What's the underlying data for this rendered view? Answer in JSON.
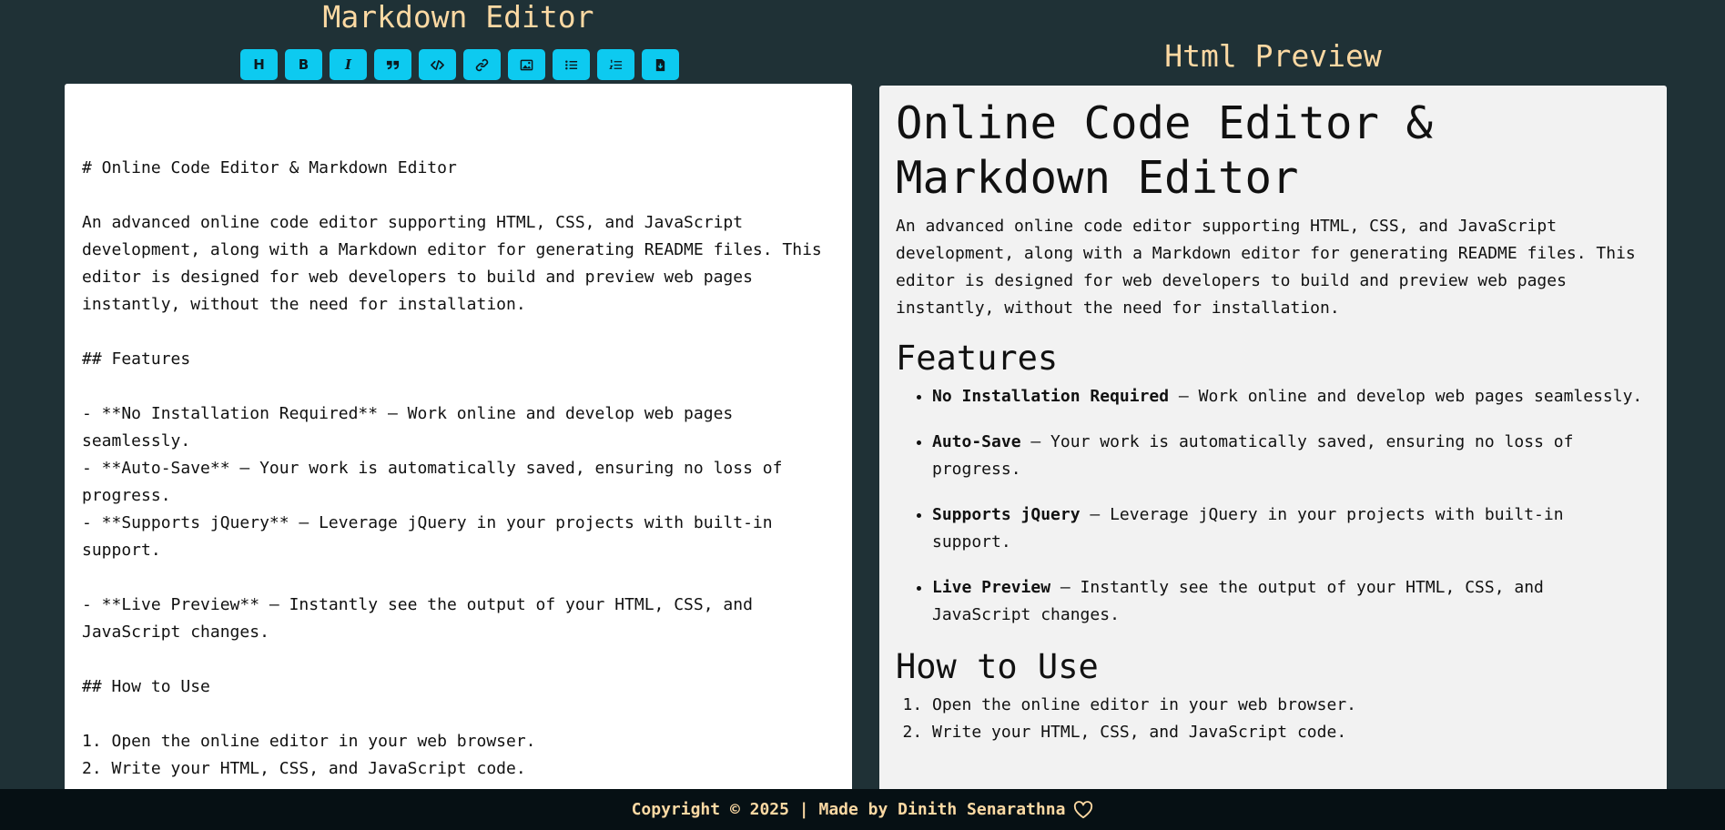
{
  "editor_panel": {
    "title": "Markdown Editor",
    "toolbar": [
      {
        "label": "H",
        "icon": "heading-icon"
      },
      {
        "label": "B",
        "icon": "bold-icon"
      },
      {
        "label": "I",
        "icon": "italic-icon"
      },
      {
        "label": "",
        "icon": "quote-icon"
      },
      {
        "label": "",
        "icon": "code-icon"
      },
      {
        "label": "",
        "icon": "link-icon"
      },
      {
        "label": "",
        "icon": "image-icon"
      },
      {
        "label": "",
        "icon": "unordered-list-icon"
      },
      {
        "label": "",
        "icon": "ordered-list-icon"
      },
      {
        "label": "",
        "icon": "file-download-icon"
      }
    ],
    "content": "# Online Code Editor & Markdown Editor\n\nAn advanced online code editor supporting HTML, CSS, and JavaScript development, along with a Markdown editor for generating README files. This editor is designed for web developers to build and preview web pages instantly, without the need for installation.\n\n## Features\n\n- **No Installation Required** – Work online and develop web pages seamlessly.\n- **Auto-Save** – Your work is automatically saved, ensuring no loss of progress.\n- **Supports jQuery** – Leverage jQuery in your projects with built-in support.\n\n- **Live Preview** – Instantly see the output of your HTML, CSS, and JavaScript changes.\n\n## How to Use\n\n1. Open the online editor in your web browser.\n2. Write your HTML, CSS, and JavaScript code."
  },
  "preview_panel": {
    "title": "Html Preview",
    "h1": "Online Code Editor & Markdown Editor",
    "intro": "An advanced online code editor supporting HTML, CSS, and JavaScript development, along with a Markdown editor for generating README files. This editor is designed for web developers to build and preview web pages instantly, without the need for installation.",
    "features_heading": "Features",
    "features": [
      {
        "bold": "No Installation Required",
        "text": " – Work online and develop web pages seamlessly."
      },
      {
        "bold": "Auto-Save",
        "text": " – Your work is automatically saved, ensuring no loss of progress."
      },
      {
        "bold": "Supports jQuery",
        "text": " – Leverage jQuery in your projects with built-in support."
      },
      {
        "bold": "Live Preview",
        "text": " – Instantly see the output of your HTML, CSS, and JavaScript changes."
      }
    ],
    "howto_heading": "How to Use",
    "steps": [
      "Open the online editor in your web browser.",
      "Write your HTML, CSS, and JavaScript code."
    ]
  },
  "footer": {
    "text": "Copyright © 2025 | Made by Dinith Senarathna",
    "icon": "heart-icon"
  },
  "colors": {
    "background": "#1f3136",
    "accent": "#0dcaf0",
    "title": "#fcd9a3",
    "footer_bg": "#061014"
  }
}
